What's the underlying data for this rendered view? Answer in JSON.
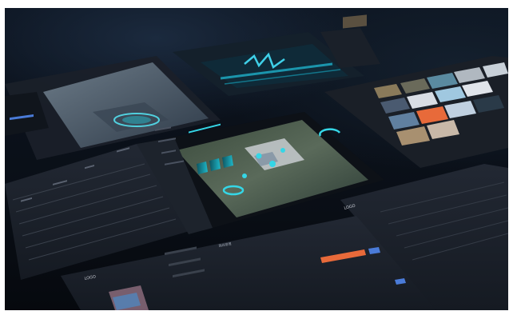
{
  "scene": {
    "kind": "perspective montage of dark dashboard application screens",
    "palette": {
      "background": "#0b111a",
      "panel": "#1b2028",
      "panel_dark": "#12161d",
      "accent_cyan": "#35d6e6",
      "accent_blue": "#4a7bd8",
      "accent_orange": "#e86a3a"
    }
  },
  "labels": {
    "top_bar_logo": "LOGO",
    "bottom_bar_logo": "LOGO",
    "tab_label": "路线管理"
  }
}
